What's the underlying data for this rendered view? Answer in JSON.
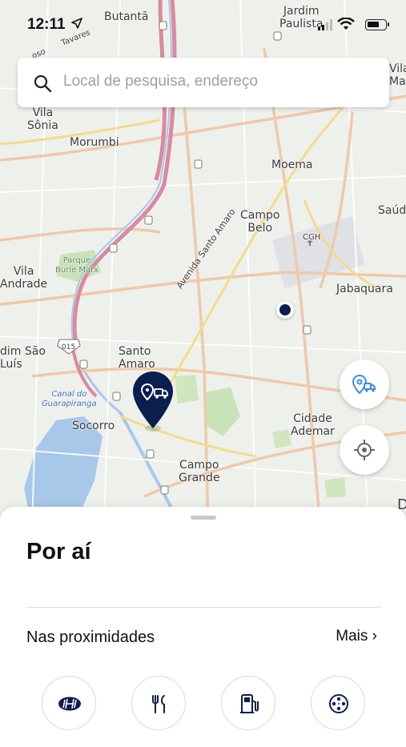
{
  "status_bar": {
    "time": "12:11"
  },
  "search": {
    "placeholder": "Local de pesquisa, endereço"
  },
  "map": {
    "labels": {
      "butanta": "Butantã",
      "jardim_paulista": "Jardim\nPaulista",
      "vila_top_right": "Vila\nMa",
      "tavares": "Tavares",
      "raposo": "oso",
      "vila_sonia": "Vila\nSônia",
      "morumbi": "Morumbi",
      "moema": "Moema",
      "avenida_santo_amaro": "Avenida Santo Amaro",
      "campo_belo": "Campo\nBelo",
      "saude": "Saúd",
      "cgh": "CGH",
      "vila_andrade": "Vila\nAndrade",
      "parque_burle_marx": "Parque\nBurle Marx",
      "jabaquara": "Jabaquara",
      "jardim_sao_luis": "dim São\nLuís",
      "route_015": "015",
      "santo_amaro": "Santo\nAmaro",
      "canal_guarapiranga": "Canal do\nGuarapiranga",
      "socorro": "Socorro",
      "cidade_ademar": "Cidade\nAdemar",
      "campo_grande": "Campo\nGrande",
      "edge_d": "D"
    }
  },
  "sheet": {
    "title": "Por aí",
    "section_label": "Nas proximidades",
    "more_label": "Mais ›"
  },
  "categories": [
    {
      "icon": "hyundai-logo-icon"
    },
    {
      "icon": "restaurant-icon"
    },
    {
      "icon": "fuel-station-icon"
    },
    {
      "icon": "cinema-film-reel-icon"
    }
  ],
  "colors": {
    "accent": "#0b1f4e",
    "map_background": "#eef0ec",
    "highway": "#d98aa0",
    "arterial": "#f0c9a8",
    "water": "#a8c8ea",
    "park": "#c9e3b8"
  }
}
